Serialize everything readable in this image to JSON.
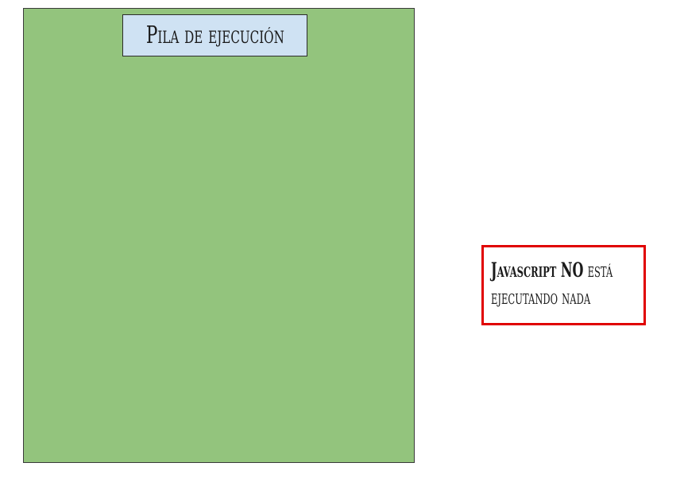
{
  "stack": {
    "title": "Pila de ejecución",
    "fill_color": "#93c47d",
    "title_fill_color": "#cfe2f3"
  },
  "note": {
    "bold_text": "Javascript NO",
    "text_line1_rest": " está",
    "text_line2": "ejecutando nada",
    "border_color": "#e00000"
  }
}
